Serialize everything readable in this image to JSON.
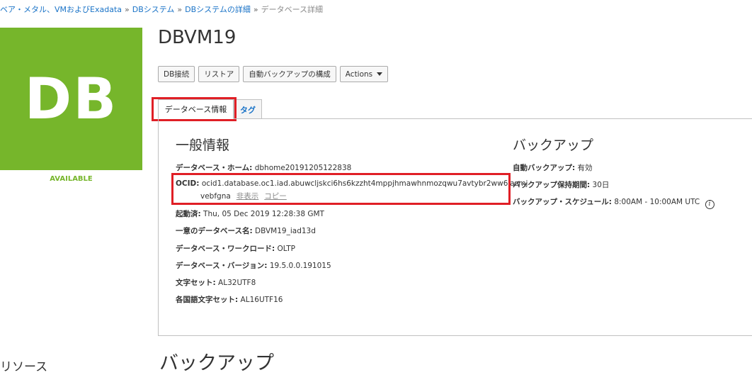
{
  "breadcrumb": {
    "items": [
      "ベア・メタル、VMおよびExadata",
      "DBシステム",
      "DBシステムの詳細"
    ],
    "separator": "»",
    "current": "データベース詳細"
  },
  "tile": {
    "text": "DB",
    "color": "#76b62b"
  },
  "status": "AVAILABLE",
  "resources_label": "リソース",
  "title": "DBVM19",
  "actions": {
    "connect": "DB接続",
    "restore": "リストア",
    "configure_backup": "自動バックアップの構成",
    "actions_menu": "Actions"
  },
  "tabs": {
    "database_info": "データベース情報",
    "tags": "タグ"
  },
  "general": {
    "heading": "一般情報",
    "db_home_label": "データベース・ホーム:",
    "db_home_value": "dbhome20191205122838",
    "ocid_label": "OCID:",
    "ocid_line1": "ocid1.database.oc1.iad.abuwcljskci6hs6kzzht4mppjhmawhnmozqwu7avtybr2ww6iazmj",
    "ocid_line2": "vebfgna",
    "ocid_hide": "非表示",
    "ocid_copy": "コピー",
    "started_label": "起動済:",
    "started_value": "Thu, 05 Dec 2019 12:28:38 GMT",
    "unique_name_label": "一意のデータベース名:",
    "unique_name_value": "DBVM19_iad13d",
    "workload_label": "データベース・ワークロード:",
    "workload_value": "OLTP",
    "version_label": "データベース・バージョン:",
    "version_value": "19.5.0.0.191015",
    "charset_label": "文字セット:",
    "charset_value": "AL32UTF8",
    "ncharset_label": "各国語文字セット:",
    "ncharset_value": "AL16UTF16"
  },
  "backup": {
    "heading": "バックアップ",
    "auto_label": "自動バックアップ:",
    "auto_value": "有効",
    "retention_label": "バックアップ保持期間:",
    "retention_value": "30日",
    "schedule_label": "バックアップ・スケジュール:",
    "schedule_value": "8:00AM - 10:00AM UTC",
    "info_icon": "i"
  },
  "bottom_heading": "バックアップ",
  "colors": {
    "highlight": "#e01f26",
    "link": "#1a73c7",
    "accent": "#76b62b"
  }
}
